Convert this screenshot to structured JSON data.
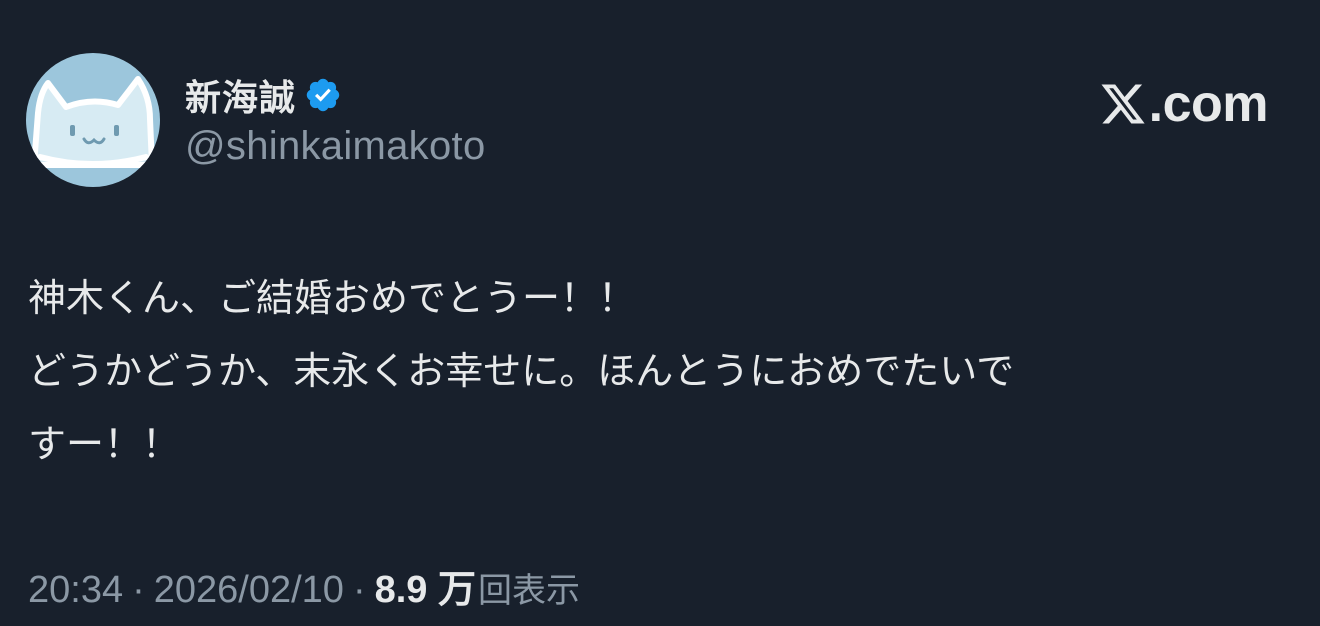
{
  "author": {
    "display_name": "新海誠",
    "handle": "@shinkaimakoto",
    "verified": true,
    "avatar": "cat-face-avatar"
  },
  "brand": {
    "logo": "x-logo",
    "site_text": ".com"
  },
  "tweet": {
    "lines": [
      "神木くん、ご結婚おめでとうー！！",
      "どうかどうか、末永くお幸せに。ほんとうにおめでたいで",
      "すー！！"
    ]
  },
  "meta": {
    "time": "20:34",
    "separator": "·",
    "date": "2026/02/10",
    "views_count": "8.9 万",
    "views_label": "回表示"
  },
  "colors": {
    "background": "#18202c",
    "text_primary": "#e7e9ea",
    "text_secondary": "#8b98a5",
    "verified_badge": "#1d9bf0",
    "avatar_bg": "#9cc6dc"
  }
}
